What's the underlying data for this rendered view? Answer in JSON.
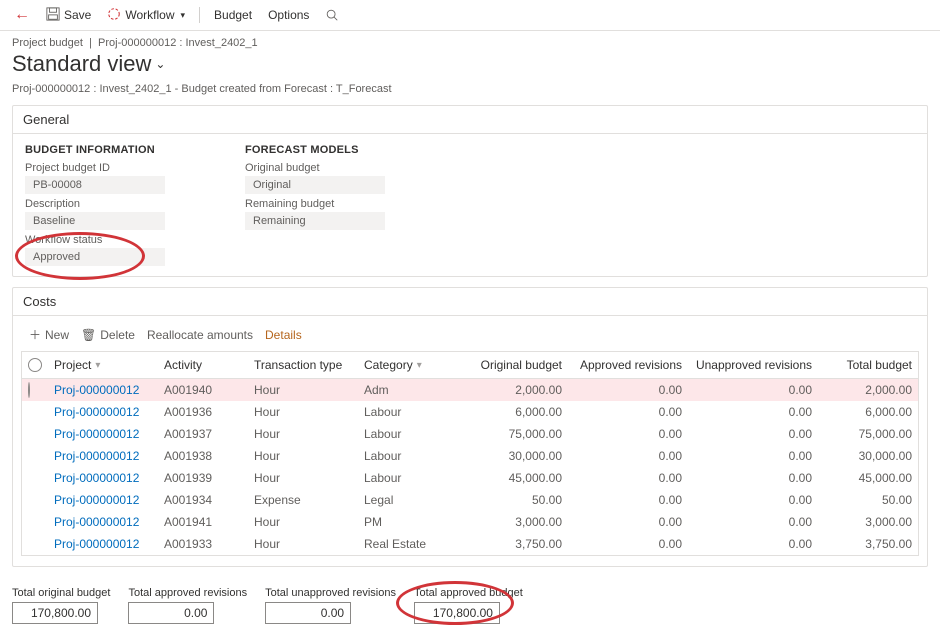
{
  "toolbar": {
    "save": "Save",
    "workflow": "Workflow",
    "budget": "Budget",
    "options": "Options"
  },
  "breadcrumb": {
    "module": "Project budget",
    "project": "Proj-000000012 : Invest_2402_1"
  },
  "title": "Standard view",
  "subtitle": "Proj-000000012 : Invest_2402_1 - Budget created from Forecast : T_Forecast",
  "general": {
    "header": "General",
    "budget_info_title": "BUDGET INFORMATION",
    "forecast_models_title": "FORECAST MODELS",
    "labels": {
      "budget_id": "Project budget ID",
      "description": "Description",
      "workflow_status": "Workflow status",
      "original_budget": "Original budget",
      "remaining_budget": "Remaining budget"
    },
    "values": {
      "budget_id": "PB-00008",
      "description": "Baseline",
      "workflow_status": "Approved",
      "original_budget": "Original",
      "remaining_budget": "Remaining"
    }
  },
  "costs": {
    "header": "Costs",
    "toolbar": {
      "new": "New",
      "delete": "Delete",
      "reallocate": "Reallocate amounts",
      "details": "Details"
    },
    "columns": {
      "project": "Project",
      "activity": "Activity",
      "txn_type": "Transaction type",
      "category": "Category",
      "orig_budget": "Original budget",
      "appr_rev": "Approved revisions",
      "unappr_rev": "Unapproved revisions",
      "total_budget": "Total budget"
    },
    "rows": [
      {
        "project": "Proj-000000012",
        "activity": "A001940",
        "txn": "Hour",
        "category": "Adm",
        "orig": "2,000.00",
        "appr": "0.00",
        "unappr": "0.00",
        "total": "2,000.00",
        "selected": true
      },
      {
        "project": "Proj-000000012",
        "activity": "A001936",
        "txn": "Hour",
        "category": "Labour",
        "orig": "6,000.00",
        "appr": "0.00",
        "unappr": "0.00",
        "total": "6,000.00"
      },
      {
        "project": "Proj-000000012",
        "activity": "A001937",
        "txn": "Hour",
        "category": "Labour",
        "orig": "75,000.00",
        "appr": "0.00",
        "unappr": "0.00",
        "total": "75,000.00"
      },
      {
        "project": "Proj-000000012",
        "activity": "A001938",
        "txn": "Hour",
        "category": "Labour",
        "orig": "30,000.00",
        "appr": "0.00",
        "unappr": "0.00",
        "total": "30,000.00"
      },
      {
        "project": "Proj-000000012",
        "activity": "A001939",
        "txn": "Hour",
        "category": "Labour",
        "orig": "45,000.00",
        "appr": "0.00",
        "unappr": "0.00",
        "total": "45,000.00"
      },
      {
        "project": "Proj-000000012",
        "activity": "A001934",
        "txn": "Expense",
        "category": "Legal",
        "orig": "50.00",
        "appr": "0.00",
        "unappr": "0.00",
        "total": "50.00"
      },
      {
        "project": "Proj-000000012",
        "activity": "A001941",
        "txn": "Hour",
        "category": "PM",
        "orig": "3,000.00",
        "appr": "0.00",
        "unappr": "0.00",
        "total": "3,000.00"
      },
      {
        "project": "Proj-000000012",
        "activity": "A001933",
        "txn": "Hour",
        "category": "Real Estate",
        "orig": "3,750.00",
        "appr": "0.00",
        "unappr": "0.00",
        "total": "3,750.00"
      }
    ]
  },
  "totals": {
    "labels": {
      "orig": "Total original budget",
      "appr": "Total approved revisions",
      "unappr": "Total unapproved revisions",
      "total": "Total approved budget"
    },
    "values": {
      "orig": "170,800.00",
      "appr": "0.00",
      "unappr": "0.00",
      "total": "170,800.00"
    }
  }
}
